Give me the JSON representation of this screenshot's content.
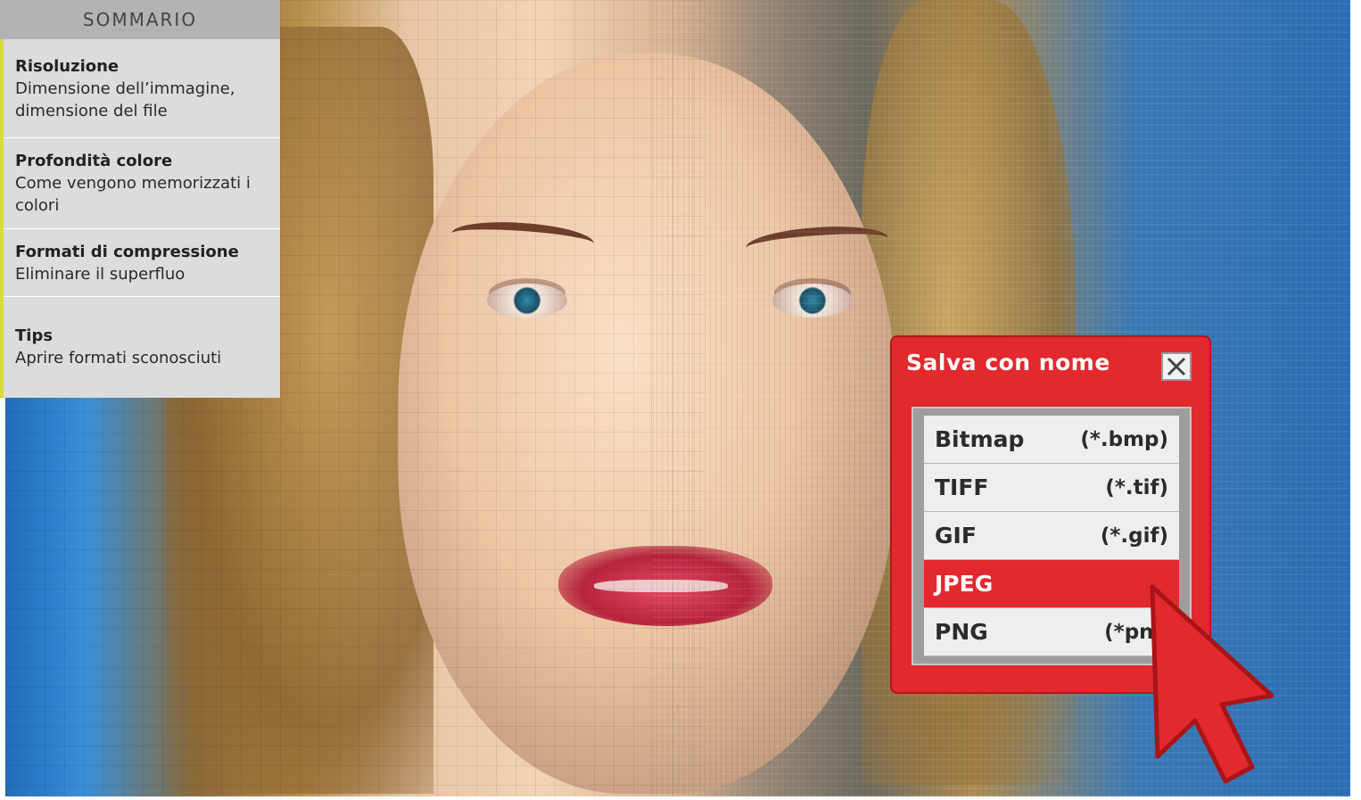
{
  "sommario": {
    "header": "SOMMARIO",
    "items": [
      {
        "title": "Risoluzione",
        "subtitle": "Dimensione dell’immagine, dimensione del file"
      },
      {
        "title": "Profondità colore",
        "subtitle": "Come vengono memorizzati i colori"
      },
      {
        "title": "Formati di compressione",
        "subtitle": "Eliminare il superfluo"
      },
      {
        "title": "Tips",
        "subtitle": "Aprire formati sconosciuti"
      }
    ]
  },
  "dialog": {
    "title": "Salva con nome",
    "close_icon": "close-icon",
    "formats": [
      {
        "name": "Bitmap",
        "ext": "(*.bmp)"
      },
      {
        "name": "TIFF",
        "ext": "(*.tif)"
      },
      {
        "name": "GIF",
        "ext": "(*.gif)"
      },
      {
        "name": "JPEG",
        "ext": ""
      },
      {
        "name": "PNG",
        "ext": "(*png"
      }
    ],
    "selected": "JPEG"
  },
  "colors": {
    "accent_red": "#e2292d",
    "sidebar_bg": "#dcdcdc",
    "sidebar_header_bg": "#b3b3b3",
    "sidebar_accent_bar": "#d8dc3a"
  }
}
